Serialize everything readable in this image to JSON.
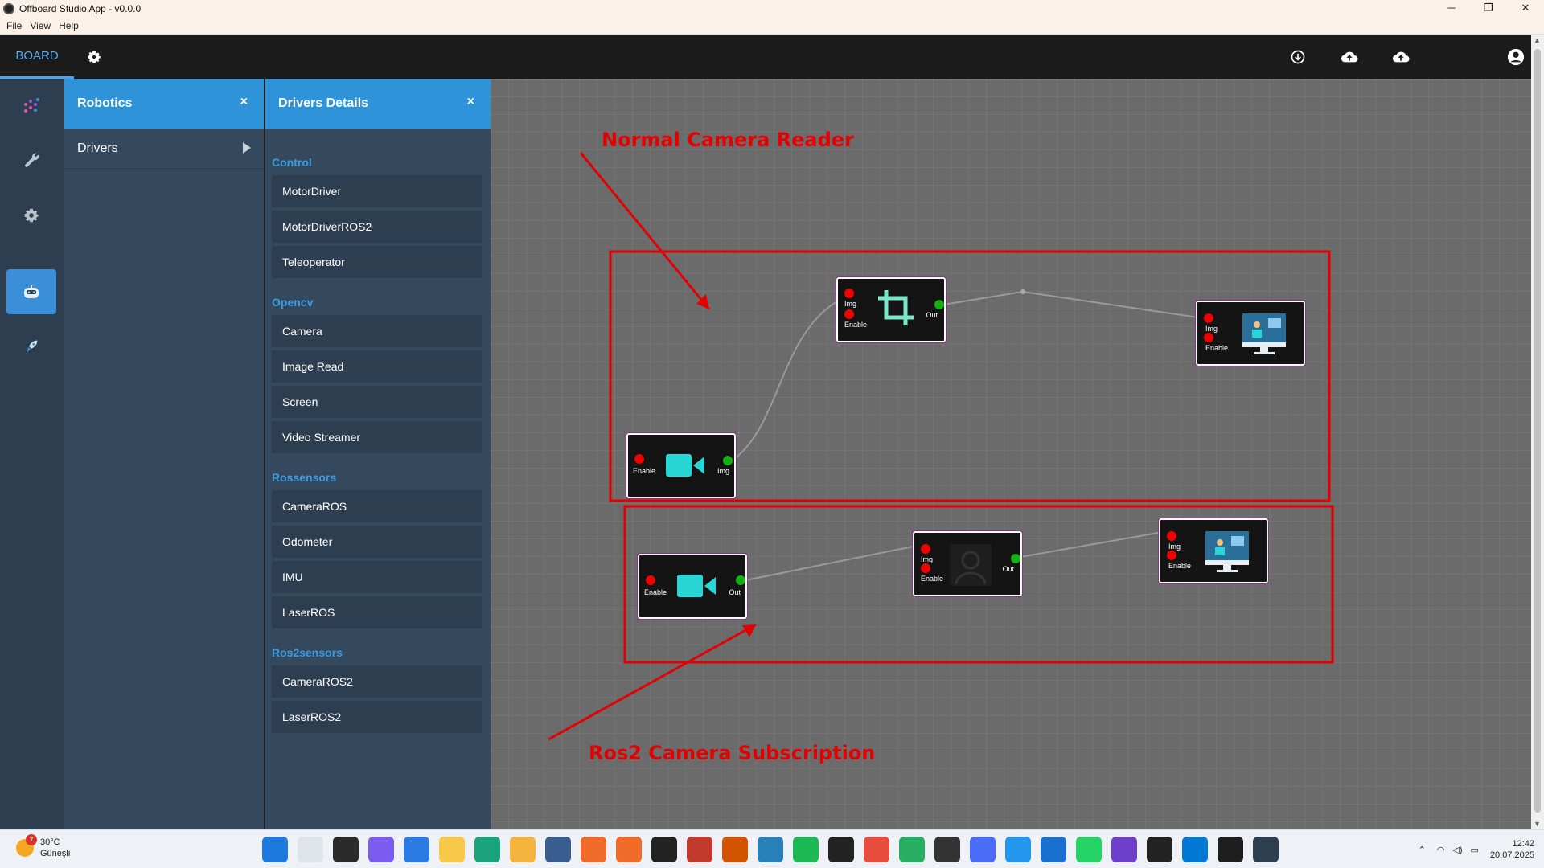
{
  "window": {
    "title": "Offboard Studio App - v0.0.0",
    "controls": [
      "─",
      "❐",
      "✕"
    ]
  },
  "menu": [
    "File",
    "View",
    "Help"
  ],
  "header": {
    "tab_board": "BOARD",
    "icons": [
      "settings-icon",
      "download-icon",
      "upload-cloud-icon",
      "upload-cloud-icon-2",
      "account-icon"
    ]
  },
  "rail": {
    "items": [
      "nodes-icon",
      "wrench-icon",
      "gear-icon",
      "robot-icon",
      "rocket-icon"
    ],
    "active_index": 3
  },
  "robotics_panel": {
    "title": "Robotics",
    "close": "×",
    "items": [
      {
        "label": "Drivers"
      }
    ]
  },
  "drivers_panel": {
    "title": "Drivers Details",
    "close": "×",
    "categories": [
      {
        "name": "Control",
        "items": [
          "MotorDriver",
          "MotorDriverROS2",
          "Teleoperator"
        ]
      },
      {
        "name": "Opencv",
        "items": [
          "Camera",
          "Image Read",
          "Screen",
          "Video Streamer"
        ]
      },
      {
        "name": "Rossensors",
        "items": [
          "CameraROS",
          "Odometer",
          "IMU",
          "LaserROS"
        ]
      },
      {
        "name": "Ros2sensors",
        "items": [
          "CameraROS2",
          "LaserROS2"
        ]
      }
    ]
  },
  "canvas": {
    "annotation_top": "Normal Camera Reader",
    "annotation_bottom": "Ros2 Camera Subscription",
    "port_labels": {
      "img": "Img",
      "enable": "Enable",
      "out": "Out"
    },
    "colors": {
      "annotation": "#e00000",
      "port_input": "#f00000",
      "port_output": "#14b014",
      "icon_accent": "#29d6d6"
    }
  },
  "taskbar": {
    "temperature": "30°C",
    "weather": "Güneşli",
    "weather_badge": "7",
    "time": "12:42",
    "date": "20.07.2025"
  }
}
